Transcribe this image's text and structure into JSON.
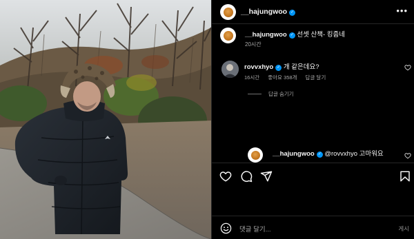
{
  "post": {
    "username": "__hajungwoo",
    "more_label": "•••"
  },
  "caption": {
    "username": "__hajungwoo",
    "text": "선셋 산책- 킹줍네",
    "time": "20시간"
  },
  "comments": [
    {
      "username": "rovvxhyo",
      "text": "개 같은데요?",
      "time": "16시간",
      "likes": "좋아요 358개",
      "reply_label": "답글 달기"
    }
  ],
  "hide_replies_label": "답글 숨기기",
  "reply": {
    "username": "__hajungwoo",
    "text": "@rovvxhyo 고마워요"
  },
  "composer": {
    "placeholder": "댓글 달기...",
    "post_label": "게시"
  },
  "icons": {
    "verified": "verified-badge-icon",
    "heart": "heart-icon",
    "comment": "comment-icon",
    "share": "paper-plane-icon",
    "save": "bookmark-icon",
    "emoji": "smiley-icon"
  },
  "colors": {
    "background": "#000000",
    "verified_blue": "#0095f6",
    "secondary_text": "#a8a8a8"
  }
}
